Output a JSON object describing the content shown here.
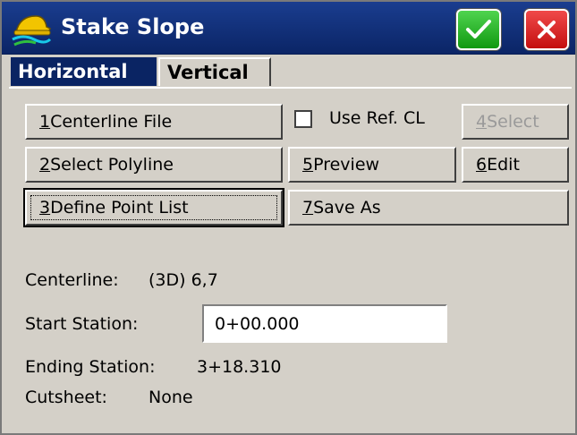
{
  "window": {
    "title": "Stake Slope",
    "ok_icon": "check-icon",
    "close_icon": "close-icon",
    "ok_color": "#22b022",
    "close_color": "#dd1e1e"
  },
  "tabs": [
    {
      "label": "Horizontal",
      "active": true
    },
    {
      "label": "Vertical",
      "active": false
    }
  ],
  "buttons": {
    "centerline_file": {
      "num": "1",
      "text": " Centerline File"
    },
    "select_polyline": {
      "num": "2",
      "text": " Select Polyline"
    },
    "define_point_list": {
      "num": "3",
      "text": " Define Point List"
    },
    "select": {
      "num": "4",
      "text": " Select",
      "disabled": true
    },
    "preview": {
      "num": "5",
      "text": " Preview"
    },
    "edit": {
      "num": "6",
      "text": " Edit"
    },
    "save_as": {
      "num": "7",
      "text": " Save As"
    }
  },
  "use_ref_cl": {
    "label": "Use Ref. CL",
    "checked": false
  },
  "info": {
    "centerline_label": "Centerline:",
    "centerline_value": "(3D) 6,7",
    "start_station_label": "Start Station:",
    "start_station_value": "0+00.000",
    "ending_station_label": "Ending Station:",
    "ending_station_value": "3+18.310",
    "cutsheet_label": "Cutsheet:",
    "cutsheet_value": "None"
  }
}
